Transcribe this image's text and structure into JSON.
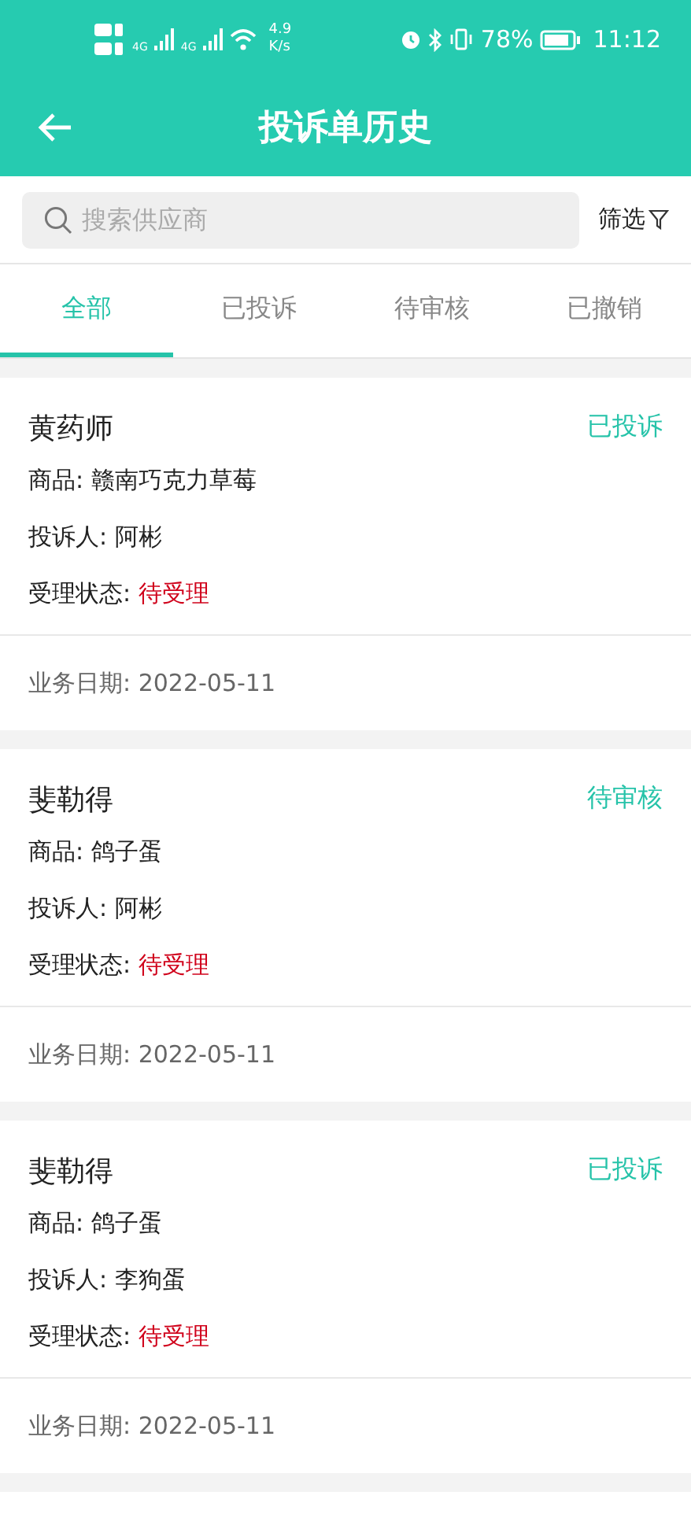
{
  "status_bar": {
    "networks": [
      {
        "label": "4G"
      },
      {
        "label": "4G"
      }
    ],
    "speed": "4.9",
    "speed_unit": "K/s",
    "battery": "78%",
    "time": "11:12"
  },
  "header": {
    "title": "投诉单历史"
  },
  "search": {
    "placeholder": "搜索供应商",
    "filter": "筛选"
  },
  "tabs": [
    {
      "label": "全部",
      "selected": true
    },
    {
      "label": "已投诉",
      "selected": false
    },
    {
      "label": "待审核",
      "selected": false
    },
    {
      "label": "已撤销",
      "selected": false
    }
  ],
  "records": [
    {
      "name": "黄药师",
      "status": "已投诉",
      "product": "商品: 赣南巧克力草莓",
      "complainant": "投诉人: 阿彬",
      "handling_label": "受理状态:",
      "handling": "待受理",
      "date": "业务日期: 2022-05-11"
    },
    {
      "name": "斐勒得",
      "status": "待审核",
      "product": "商品: 鸽子蛋",
      "complainant": "投诉人: 阿彬",
      "handling_label": "受理状态:",
      "handling": "待受理",
      "date": "业务日期: 2022-05-11"
    },
    {
      "name": "斐勒得",
      "status": "已投诉",
      "product": "商品: 鸽子蛋",
      "complainant": "投诉人: 李狗蛋",
      "handling_label": "受理状态:",
      "handling": "待受理",
      "date": "业务日期: 2022-05-11"
    }
  ]
}
